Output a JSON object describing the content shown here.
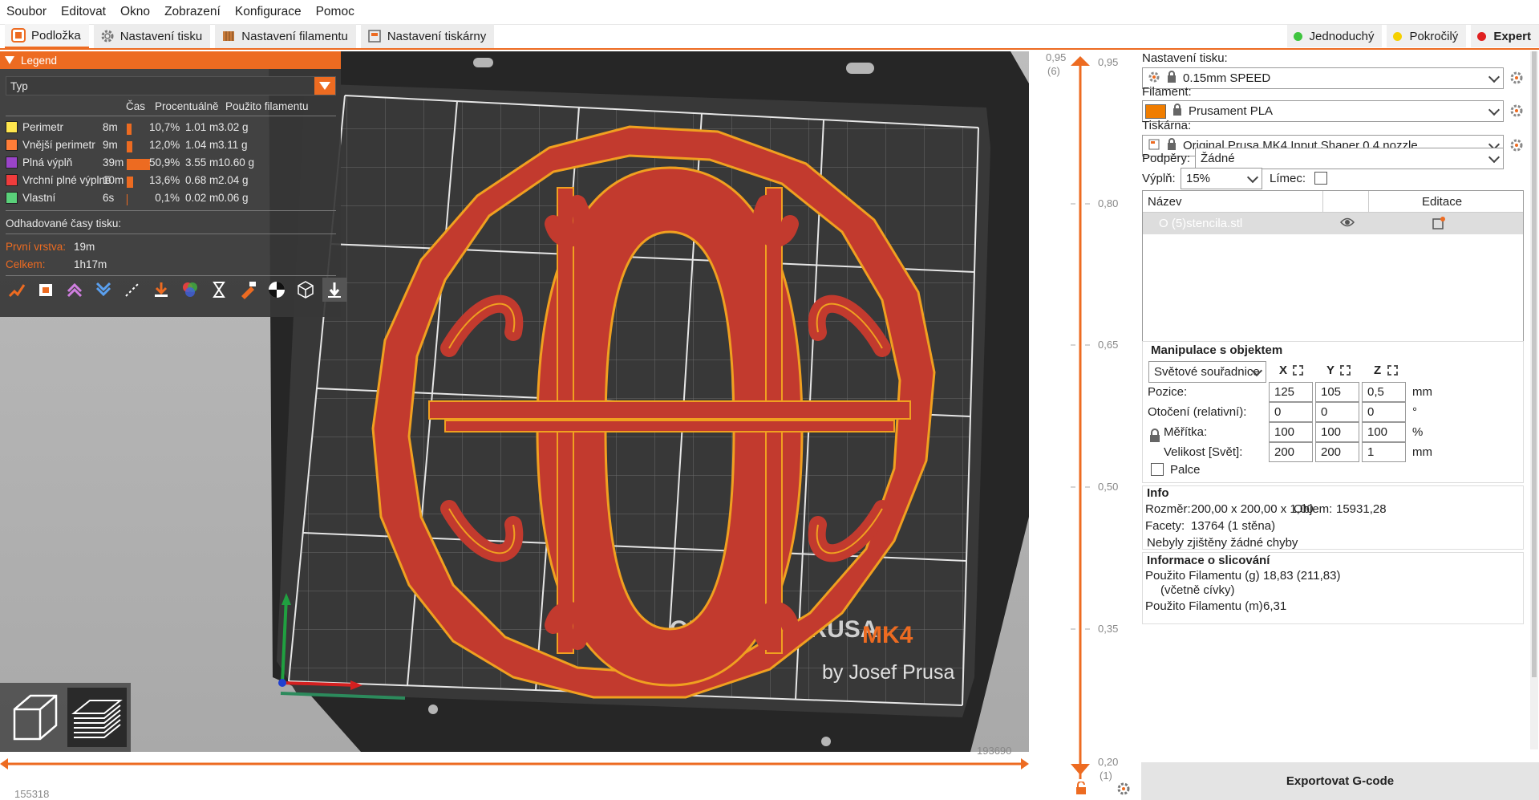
{
  "menu": [
    "Soubor",
    "Editovat",
    "Okno",
    "Zobrazení",
    "Konfigurace",
    "Pomoc"
  ],
  "tabs": [
    {
      "label": "Podložka",
      "active": true
    },
    {
      "label": "Nastavení tisku",
      "active": false
    },
    {
      "label": "Nastavení filamentu",
      "active": false
    },
    {
      "label": "Nastavení tiskárny",
      "active": false
    }
  ],
  "modes": [
    {
      "label": "Jednoduchý",
      "color": "#3fc43f"
    },
    {
      "label": "Pokročilý",
      "color": "#f5d000"
    },
    {
      "label": "Expert",
      "color": "#e02020"
    }
  ],
  "legend": {
    "title": "Legend",
    "view_type": "Typ",
    "headers": {
      "time": "Čas",
      "percent": "Procentuálně",
      "filament": "Použito filamentu"
    },
    "rows": [
      {
        "name": "Perimetr",
        "color": "#ffe64d",
        "time": "8m",
        "percent": "10,7%",
        "pct": 10.7,
        "length": "1.01 m",
        "weight": "3.02 g"
      },
      {
        "name": "Vnější perimetr",
        "color": "#ff7d38",
        "time": "9m",
        "percent": "12,0%",
        "pct": 12.0,
        "length": "1.04 m",
        "weight": "3.11 g"
      },
      {
        "name": "Plná výplň",
        "color": "#9a44c8",
        "time": "39m",
        "percent": "50,9%",
        "pct": 50.9,
        "length": "3.55 m",
        "weight": "10.60 g"
      },
      {
        "name": "Vrchní plné výplně",
        "color": "#f03c3c",
        "time": "10m",
        "percent": "13,6%",
        "pct": 13.6,
        "length": "0.68 m",
        "weight": "2.04 g"
      },
      {
        "name": "Vlastní",
        "color": "#5ad17a",
        "time": "6s",
        "percent": "0,1%",
        "pct": 0.1,
        "length": "0.02 m",
        "weight": "0.06 g"
      }
    ],
    "estimated_title": "Odhadované časy tisku:",
    "first_layer_label": "První vrstva:",
    "first_layer_value": "19m",
    "total_label": "Celkem:",
    "total_value": "1h17m"
  },
  "viewport": {
    "bed_logo_brand": "ORIGINAL PRUSA",
    "bed_logo_model": "MK4",
    "bed_logo_by": "by Josef Prusa",
    "letter": "O"
  },
  "hslider": {
    "left_value": "155318",
    "right_value": "193690"
  },
  "vslider": {
    "top_value": "0,95",
    "top_layer": "(6)",
    "top_value_right": "0,95",
    "ticks": [
      "0,80",
      "0,65",
      "0,50",
      "0,35"
    ],
    "bottom_value": "0,20",
    "bottom_layer": "(1)"
  },
  "sidebar": {
    "print_settings_label": "Nastavení tisku:",
    "print_settings_value": "0.15mm SPEED",
    "filament_label": "Filament:",
    "filament_value": "Prusament PLA",
    "filament_color": "#f07d00",
    "printer_label": "Tiskárna:",
    "printer_value": "Original Prusa MK4 Input Shaper 0.4 nozzle",
    "supports_label": "Podpěry:",
    "supports_value": "Žádné",
    "infill_label": "Výplň:",
    "infill_value": "15%",
    "brim_label": "Límec:",
    "objlist": {
      "col_name": "Název",
      "col_edit": "Editace",
      "object_name": "O (5)stencila.stl"
    },
    "manip": {
      "title": "Manipulace s objektem",
      "coord_system": "Světové souřadnice",
      "axes": [
        "X",
        "Y",
        "Z"
      ],
      "position_label": "Pozice:",
      "position": [
        "125",
        "105",
        "0,5"
      ],
      "position_unit": "mm",
      "rotation_label": "Otočení (relativní):",
      "rotation": [
        "0",
        "0",
        "0"
      ],
      "rotation_unit": "°",
      "scale_label": "Měřítka:",
      "scale": [
        "100",
        "100",
        "100"
      ],
      "scale_unit": "%",
      "size_label": "Velikost [Svět]:",
      "size": [
        "200",
        "200",
        "1"
      ],
      "size_unit": "mm",
      "inches_label": "Palce"
    },
    "info": {
      "title": "Info",
      "size_label": "Rozměr:",
      "size_value": "200,00 x 200,00 x 1,00",
      "volume_label": "Objem:",
      "volume_value": "15931,28",
      "facets_label": "Facety:",
      "facets_value": "13764 (1 stěna)",
      "errors": "Nebyly zjištěny žádné chyby"
    },
    "slice_info": {
      "title": "Informace o slicování",
      "used_g_label": "Použito Filamentu (g)",
      "used_g_sub": "(včetně cívky)",
      "used_g_value": "18,83 (211,83)",
      "used_m_label": "Použito Filamentu (m)",
      "used_m_value": "6,31"
    },
    "export_label": "Exportovat G-code"
  }
}
